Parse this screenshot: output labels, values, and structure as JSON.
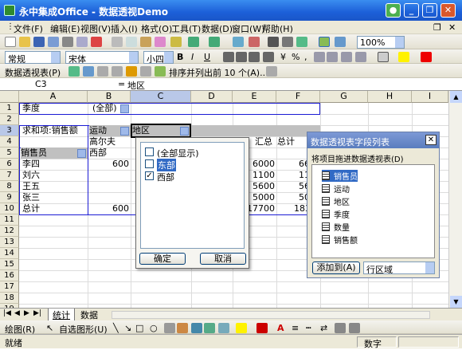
{
  "window": {
    "title": "永中集成Office - 数据透视Demo"
  },
  "menu": [
    "文件(F)",
    "编辑(E)",
    "视图(V)",
    "插入(I)",
    "格式(O)",
    "工具(T)",
    "数据(D)",
    "窗口(W)",
    "帮助(H)"
  ],
  "toolbar": {
    "zoom": "100%"
  },
  "format_toolbar": {
    "style": "常规",
    "font": "宋体",
    "size": "小四",
    "bold": "B",
    "italic": "I",
    "underline": "U",
    "percent": "%",
    "comma": ","
  },
  "pivot_toolbar": {
    "menu": "数据透视表(P)",
    "sort_label": "排序并列出前 10 个(A)..."
  },
  "formula": {
    "cell_ref": "C3",
    "eq": "=",
    "value": "地区"
  },
  "columns": [
    "A",
    "B",
    "C",
    "D",
    "E",
    "F",
    "G",
    "H",
    "I"
  ],
  "rows": [
    "1",
    "2",
    "3",
    "4",
    "5",
    "6",
    "7",
    "8",
    "9",
    "10",
    "11",
    "12",
    "13",
    "14",
    "15",
    "16",
    "17",
    "18",
    "19"
  ],
  "cells": {
    "a1": "季度",
    "b1": "(全部)",
    "a3": "求和项:销售额",
    "b3": "运动",
    "c3": "地区",
    "b4": "高尔夫",
    "a5": "销售员",
    "b5": "西部",
    "a6": "李四",
    "b6": "600",
    "a7": "刘六",
    "a8": "王五",
    "a9": "张三",
    "a10": "总计",
    "b10": "600",
    "e4": "汇总",
    "f4": "总计",
    "e6": "6000",
    "f6": "66",
    "e7": "1100",
    "f7": "11",
    "e8": "5600",
    "f8": "56",
    "e9": "5000",
    "f9": "50",
    "e10": "17700",
    "f10": "183"
  },
  "popup": {
    "items": [
      "(全部显示)",
      "东部",
      "西部"
    ],
    "checked": [
      false,
      false,
      true
    ],
    "ok": "确定",
    "cancel": "取消"
  },
  "panel": {
    "title": "数据透视表字段列表",
    "instruction": "将项目拖进数据透视表(D)",
    "fields": [
      "销售员",
      "运动",
      "地区",
      "季度",
      "数量",
      "销售额"
    ],
    "add_button": "添加到(A)",
    "area": "行区域"
  },
  "sheets": [
    "统计",
    "数据"
  ],
  "drawbar": {
    "draw": "绘图(R)",
    "autoshape": "自选图形(U)"
  },
  "status": {
    "ready": "就绪",
    "num": "数字"
  }
}
